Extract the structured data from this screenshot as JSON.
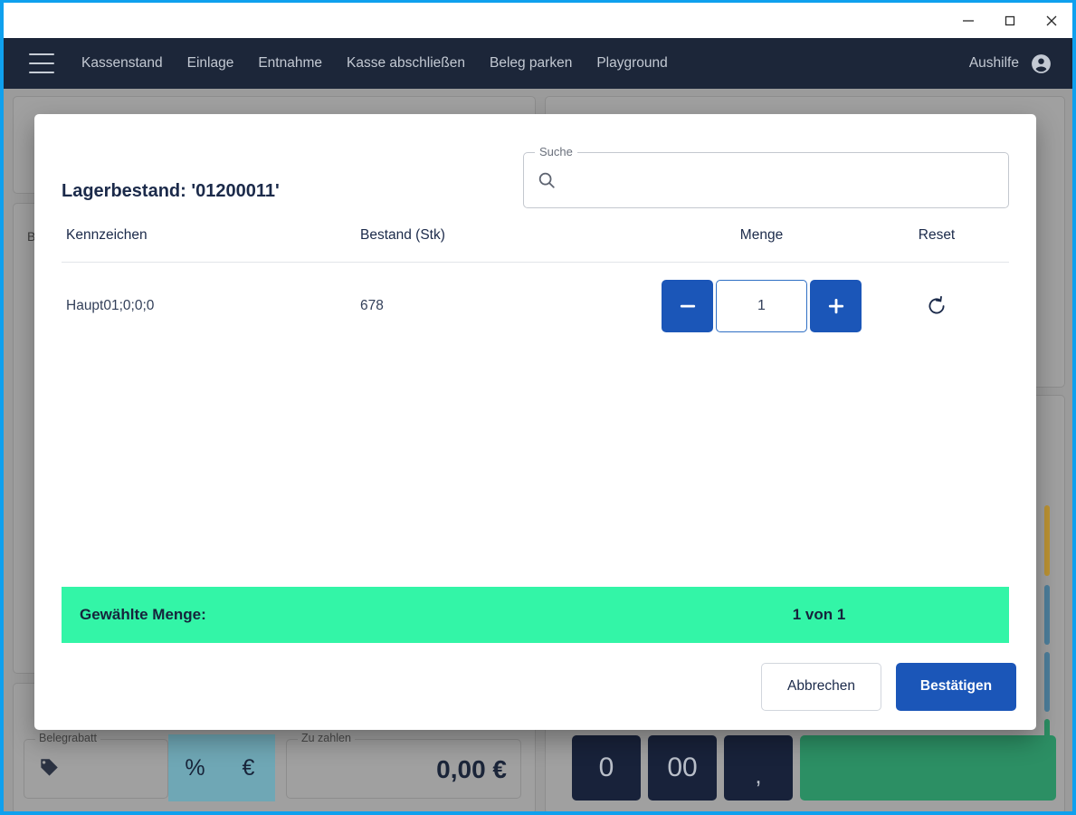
{
  "window": {
    "controls": {
      "minimize": "minimize-icon",
      "maximize": "maximize-icon",
      "close": "close-icon"
    }
  },
  "navbar": {
    "menu_icon": "hamburger-menu-icon",
    "links": [
      "Kassenstand",
      "Einlage",
      "Entnahme",
      "Kasse abschließen",
      "Beleg parken",
      "Playground"
    ],
    "user": {
      "name": "Aushilfe",
      "icon": "account-circle-icon"
    }
  },
  "background": {
    "belegrabatt_label": "Belegrabatt",
    "belegrabatt_value": "",
    "tag_icon": "tag-icon",
    "percent_button": "%",
    "euro_button": "€",
    "zu_zahlen_label": "Zu zahlen",
    "zu_zahlen_value": "0,00 €",
    "numpad": [
      "0",
      "00",
      ","
    ],
    "edge_label": "B"
  },
  "modal": {
    "title": "Lagerbestand: '01200011'",
    "search": {
      "legend": "Suche",
      "value": "",
      "placeholder": "",
      "icon": "search-icon"
    },
    "table": {
      "columns": [
        "Kennzeichen",
        "Bestand (Stk)",
        "Menge",
        "Reset"
      ],
      "rows": [
        {
          "kennzeichen": "Haupt01;0;0;0",
          "bestand": "678",
          "menge": "1",
          "decrement_label": "−",
          "increment_label": "+",
          "reset_icon": "restore-icon"
        }
      ]
    },
    "summary": {
      "label": "Gewählte Menge:",
      "value": "1 von 1"
    },
    "footer": {
      "cancel_label": "Abbrechen",
      "confirm_label": "Bestätigen"
    }
  },
  "colors": {
    "window_border": "#0fa0ee",
    "navbar_bg": "#1c2639",
    "primary_blue": "#1b56b8",
    "summary_green": "#33f5a7",
    "numpad_dark": "#18223a",
    "pay_green": "#2c8f64",
    "teal_button": "#6fa7b5"
  }
}
